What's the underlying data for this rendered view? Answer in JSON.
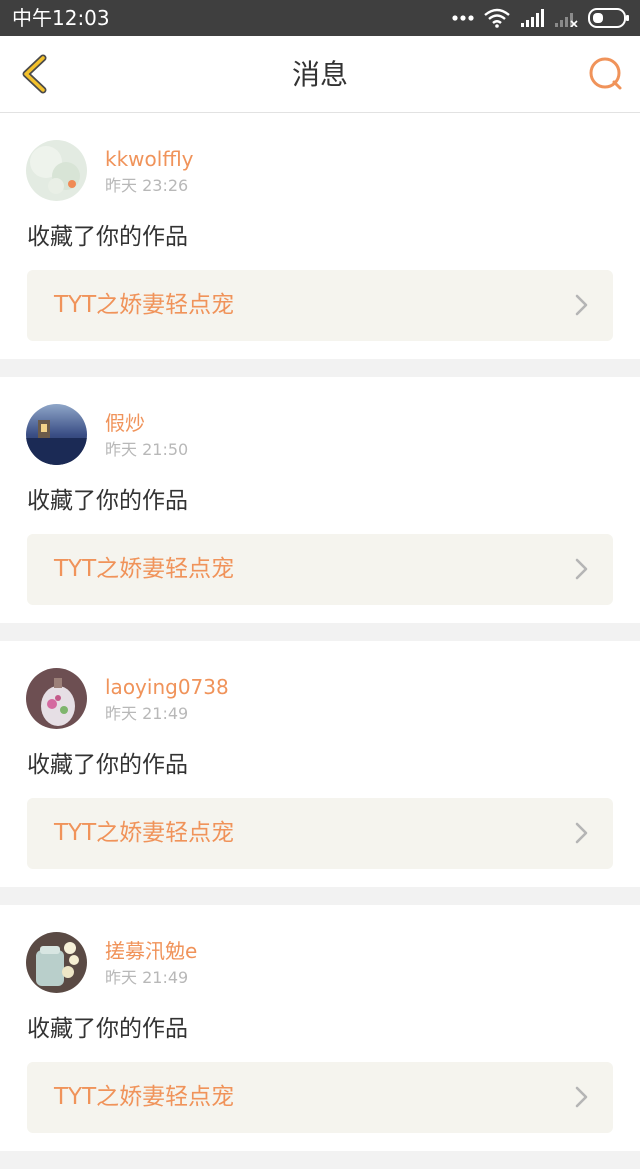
{
  "status_bar": {
    "time": "中午12:03",
    "icons": [
      "more-dots-icon",
      "wifi-icon",
      "signal-icon",
      "signal-off-icon",
      "battery-icon"
    ]
  },
  "header": {
    "title": "消息",
    "back_icon": "chevron-left-icon",
    "search_icon": "search-icon"
  },
  "colors": {
    "accent": "#f0935a",
    "back_icon": "#f3c12c",
    "card_link_bg": "#f5f4ee",
    "status_bar_bg": "#3f3f3f"
  },
  "messages": [
    {
      "username": "kkwolffly",
      "time": "昨天 23:26",
      "action": "收藏了你的作品",
      "work_title": "TYT之娇妻轻点宠"
    },
    {
      "username": "假炒",
      "time": "昨天 21:50",
      "action": "收藏了你的作品",
      "work_title": "TYT之娇妻轻点宠"
    },
    {
      "username": "laoying0738",
      "time": "昨天 21:49",
      "action": "收藏了你的作品",
      "work_title": "TYT之娇妻轻点宠"
    },
    {
      "username": "搓募汛勉e",
      "time": "昨天 21:49",
      "action": "收藏了你的作品",
      "work_title": "TYT之娇妻轻点宠"
    }
  ]
}
